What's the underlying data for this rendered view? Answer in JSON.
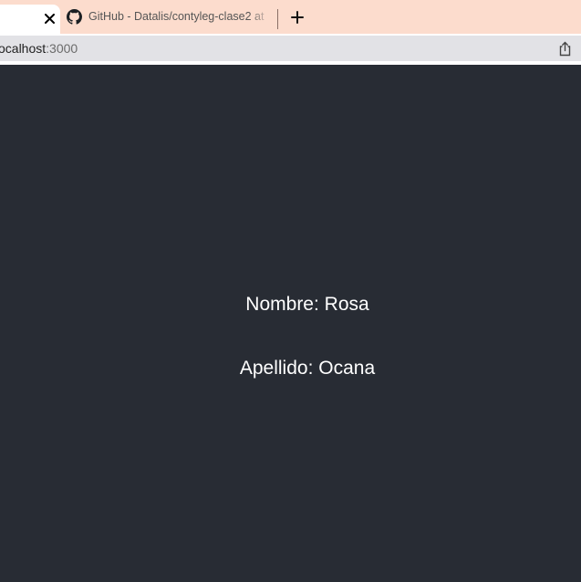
{
  "browser": {
    "tabs": [
      {
        "title": "",
        "active": true
      },
      {
        "title": "GitHub - Datalis/contyleg-clase2 at",
        "icon": "github-icon",
        "active": false
      }
    ],
    "new_tab_label": "+",
    "close_label": "×",
    "address": {
      "host": "ocalhost",
      "port": ":3000"
    },
    "share_icon": "share-icon",
    "colors": {
      "tab_strip": "#fcdccd",
      "address_bg": "#e2e2e6",
      "page_bg": "#282c34"
    }
  },
  "page": {
    "nombre": "Nombre: Rosa",
    "apellido": "Apellido: Ocana"
  }
}
